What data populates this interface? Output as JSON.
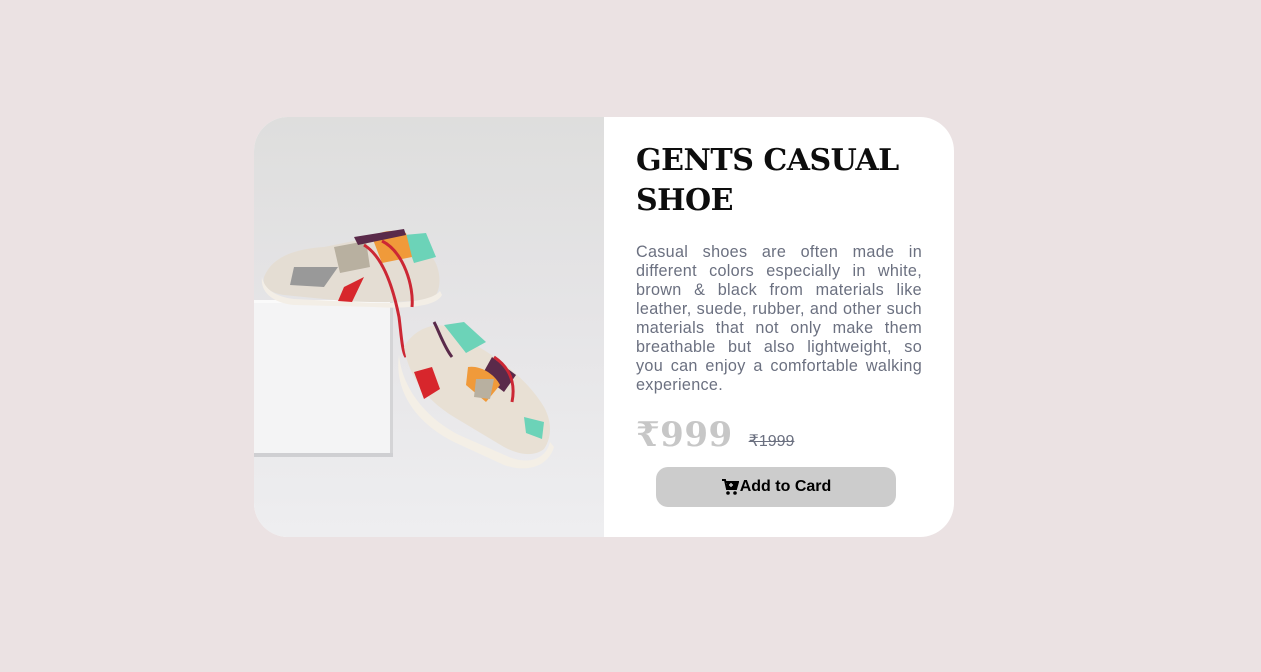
{
  "product": {
    "image_alt": "shoe-product-photo",
    "title": "GENTS CASUAL SHOE",
    "description": "Casual shoes are often made in different colors especially in white, brown & black from materials like leather, suede, rubber, and other such materials that not only make them breathable but also lightweight, so you can enjoy a comfortable walking experience.",
    "price_current": "₹999",
    "price_original": "₹1999",
    "add_button_label": "Add to Card",
    "add_button_icon": "cart-icon"
  },
  "colors": {
    "page_background": "#ebe2e3",
    "card_background": "#ffffff",
    "button_background": "#cccccc",
    "price_current": "#c7c7c7",
    "text_muted": "#6b7080"
  }
}
